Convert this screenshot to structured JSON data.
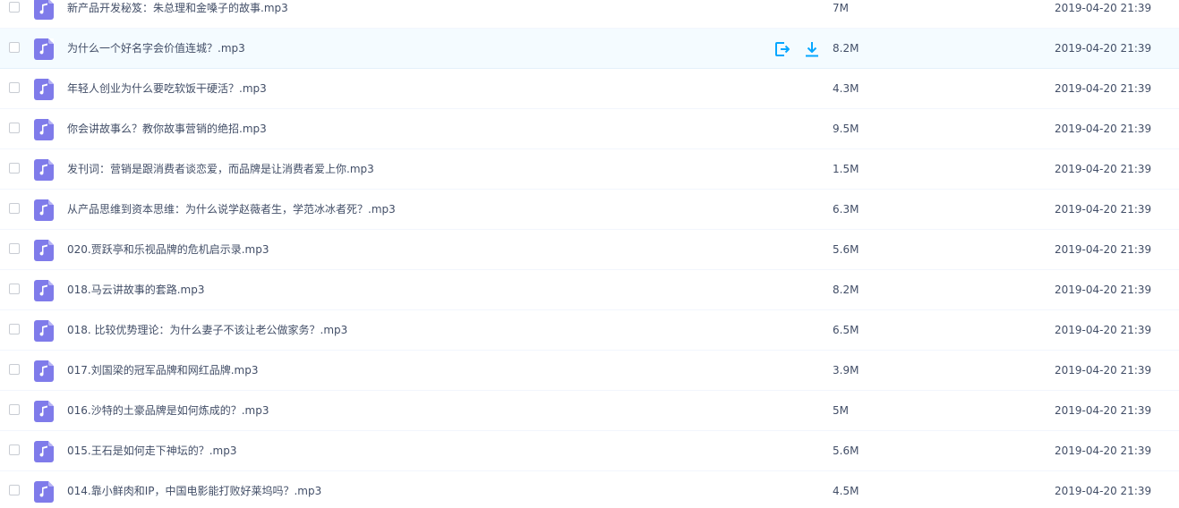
{
  "file_icon": "audio-mp3-icon",
  "row_actions": {
    "share_icon": "share-icon",
    "download_icon": "download-icon",
    "accent_color": "#06a7ff"
  },
  "files": [
    {
      "name": "新产品开发秘笈：朱总理和金嗓子的故事.mp3",
      "size": "7M",
      "modified": "2019-04-20 21:39"
    },
    {
      "name": "为什么一个好名字会价值连城？.mp3",
      "size": "8.2M",
      "modified": "2019-04-20 21:39"
    },
    {
      "name": "年轻人创业为什么要吃软饭干硬活？.mp3",
      "size": "4.3M",
      "modified": "2019-04-20 21:39"
    },
    {
      "name": "你会讲故事么？教你故事营销的绝招.mp3",
      "size": "9.5M",
      "modified": "2019-04-20 21:39"
    },
    {
      "name": "发刊词：营销是跟消费者谈恋爱，而品牌是让消费者爱上你.mp3",
      "size": "1.5M",
      "modified": "2019-04-20 21:39"
    },
    {
      "name": "从产品思维到资本思维：为什么说学赵薇者生，学范冰冰者死？.mp3",
      "size": "6.3M",
      "modified": "2019-04-20 21:39"
    },
    {
      "name": "020.贾跃亭和乐视品牌的危机启示录.mp3",
      "size": "5.6M",
      "modified": "2019-04-20 21:39"
    },
    {
      "name": "018.马云讲故事的套路.mp3",
      "size": "8.2M",
      "modified": "2019-04-20 21:39"
    },
    {
      "name": "018. 比较优势理论：为什么妻子不该让老公做家务？.mp3",
      "size": "6.5M",
      "modified": "2019-04-20 21:39"
    },
    {
      "name": "017.刘国梁的冠军品牌和网红品牌.mp3",
      "size": "3.9M",
      "modified": "2019-04-20 21:39"
    },
    {
      "name": "016.沙特的土豪品牌是如何炼成的？.mp3",
      "size": "5M",
      "modified": "2019-04-20 21:39"
    },
    {
      "name": "015.王石是如何走下神坛的？.mp3",
      "size": "5.6M",
      "modified": "2019-04-20 21:39"
    },
    {
      "name": "014.靠小鲜肉和IP，中国电影能打败好莱坞吗？.mp3",
      "size": "4.5M",
      "modified": "2019-04-20 21:39"
    }
  ]
}
